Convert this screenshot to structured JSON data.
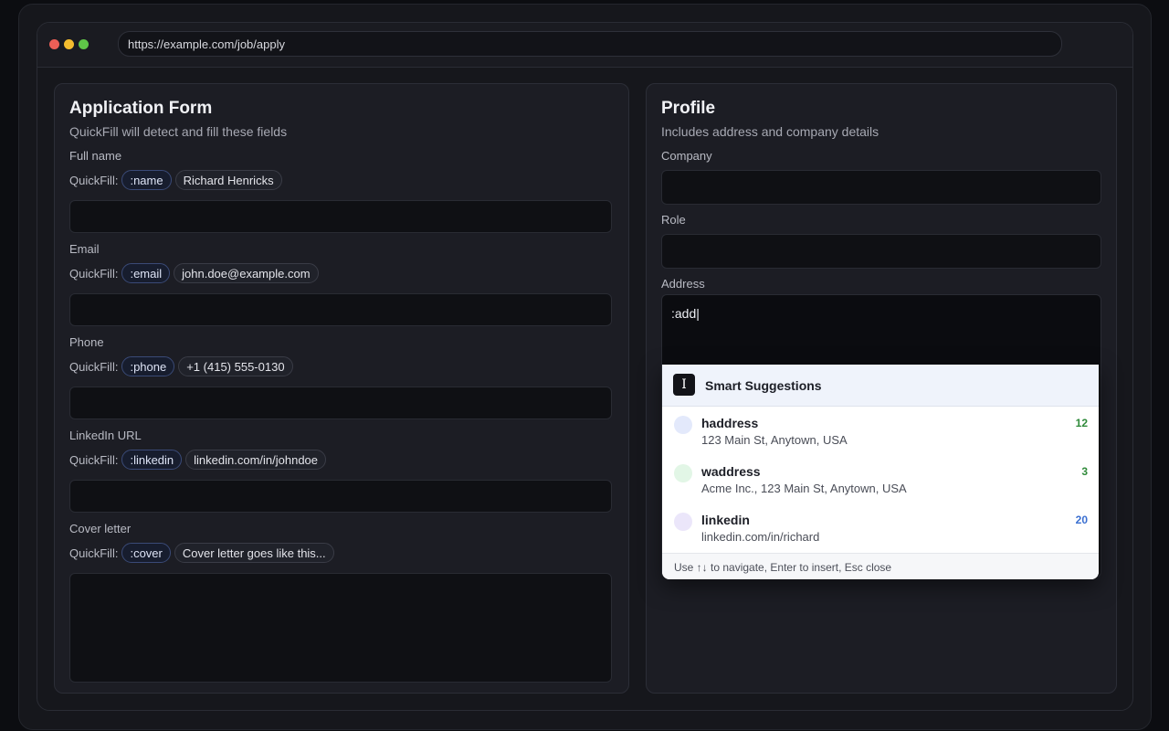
{
  "browser": {
    "url": "https://example.com/job/apply"
  },
  "form": {
    "title": "Application Form",
    "subtitle": "QuickFill will detect and fill these fields",
    "quickfill_label": "QuickFill:",
    "fields": [
      {
        "label": "Full name",
        "key": ":name",
        "value": "Richard Henricks"
      },
      {
        "label": "Email",
        "key": ":email",
        "value": "john.doe@example.com"
      },
      {
        "label": "Phone",
        "key": ":phone",
        "value": "+1 (415) 555-0130"
      },
      {
        "label": "LinkedIn URL",
        "key": ":linkedin",
        "value": "linkedin.com/in/johndoe"
      },
      {
        "label": "Cover letter",
        "key": ":cover",
        "value": "Cover letter goes like this..."
      }
    ]
  },
  "profile": {
    "title": "Profile",
    "subtitle": "Includes address and company details",
    "company_label": "Company",
    "role_label": "Role",
    "address_label": "Address",
    "address_value": ":add|"
  },
  "suggestions": {
    "title": "Smart Suggestions",
    "items": [
      {
        "name": "haddress",
        "value": "123 Main St, Anytown, USA",
        "count": "12",
        "count_color": "#2f8a3a",
        "avatar_color": "#e3e9fb"
      },
      {
        "name": "waddress",
        "value": "Acme Inc., 123 Main St, Anytown, USA",
        "count": "3",
        "count_color": "#2f8a3a",
        "avatar_color": "#e2f6e6"
      },
      {
        "name": "linkedin",
        "value": "linkedin.com/in/richard",
        "count": "20",
        "count_color": "#3a6fd1",
        "avatar_color": "#ebe6fa"
      }
    ],
    "footer": "Use ↑↓ to navigate, Enter to insert, Esc close"
  }
}
